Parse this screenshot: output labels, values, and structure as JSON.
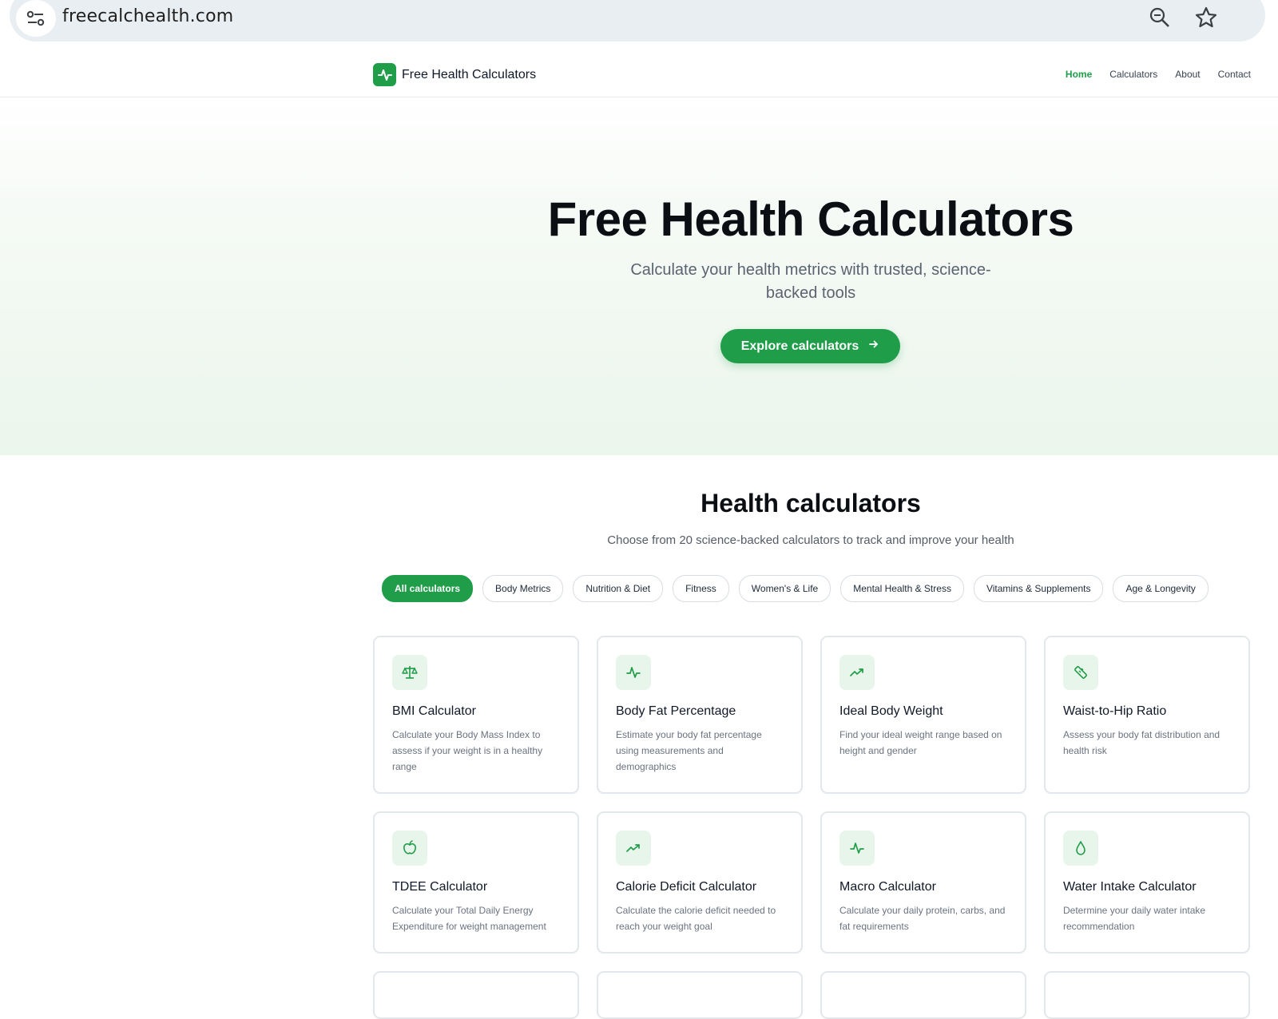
{
  "browser": {
    "url": "freecalchealth.com"
  },
  "header": {
    "logo_text": "Free Health Calculators",
    "nav": [
      {
        "label": "Home",
        "active": true
      },
      {
        "label": "Calculators",
        "active": false
      },
      {
        "label": "About",
        "active": false
      },
      {
        "label": "Contact",
        "active": false
      }
    ]
  },
  "hero": {
    "title": "Free Health Calculators",
    "subtitle": "Calculate your health metrics with trusted, science-backed tools",
    "cta_label": "Explore calculators"
  },
  "section": {
    "title": "Health calculators",
    "subtitle": "Choose from 20 science-backed calculators to track and improve your health"
  },
  "filters": [
    {
      "label": "All calculators",
      "active": true
    },
    {
      "label": "Body Metrics",
      "active": false
    },
    {
      "label": "Nutrition & Diet",
      "active": false
    },
    {
      "label": "Fitness",
      "active": false
    },
    {
      "label": "Women's & Life",
      "active": false
    },
    {
      "label": "Mental Health & Stress",
      "active": false
    },
    {
      "label": "Vitamins & Supplements",
      "active": false
    },
    {
      "label": "Age & Longevity",
      "active": false
    }
  ],
  "cards": [
    {
      "title": "BMI Calculator",
      "desc": "Calculate your Body Mass Index to assess if your weight is in a healthy range",
      "icon": "scale-icon"
    },
    {
      "title": "Body Fat Percentage",
      "desc": "Estimate your body fat percentage using measurements and demographics",
      "icon": "activity-icon"
    },
    {
      "title": "Ideal Body Weight",
      "desc": "Find your ideal weight range based on height and gender",
      "icon": "trending-up-icon"
    },
    {
      "title": "Waist-to-Hip Ratio",
      "desc": "Assess your body fat distribution and health risk",
      "icon": "ruler-icon"
    },
    {
      "title": "TDEE Calculator",
      "desc": "Calculate your Total Daily Energy Expenditure for weight management",
      "icon": "apple-icon"
    },
    {
      "title": "Calorie Deficit Calculator",
      "desc": "Calculate the calorie deficit needed to reach your weight goal",
      "icon": "trending-up-icon"
    },
    {
      "title": "Macro Calculator",
      "desc": "Calculate your daily protein, carbs, and fat requirements",
      "icon": "activity-icon"
    },
    {
      "title": "Water Intake Calculator",
      "desc": "Determine your daily water intake recommendation",
      "icon": "droplet-icon"
    }
  ],
  "colors": {
    "accent": "#1f9d49",
    "accent_soft": "#e8f5ea"
  }
}
